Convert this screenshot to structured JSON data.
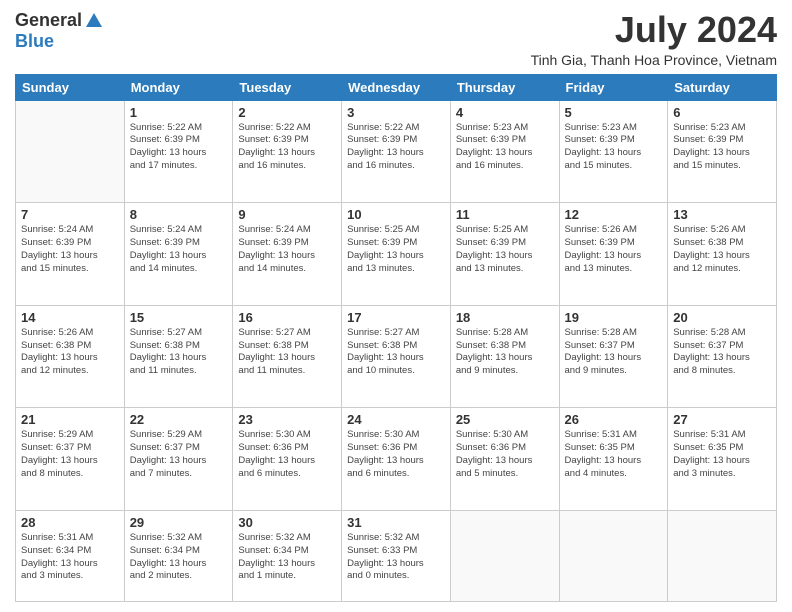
{
  "logo": {
    "general": "General",
    "blue": "Blue"
  },
  "header": {
    "month": "July 2024",
    "location": "Tinh Gia, Thanh Hoa Province, Vietnam"
  },
  "days_of_week": [
    "Sunday",
    "Monday",
    "Tuesday",
    "Wednesday",
    "Thursday",
    "Friday",
    "Saturday"
  ],
  "weeks": [
    [
      {
        "day": "",
        "info": ""
      },
      {
        "day": "1",
        "info": "Sunrise: 5:22 AM\nSunset: 6:39 PM\nDaylight: 13 hours\nand 17 minutes."
      },
      {
        "day": "2",
        "info": "Sunrise: 5:22 AM\nSunset: 6:39 PM\nDaylight: 13 hours\nand 16 minutes."
      },
      {
        "day": "3",
        "info": "Sunrise: 5:22 AM\nSunset: 6:39 PM\nDaylight: 13 hours\nand 16 minutes."
      },
      {
        "day": "4",
        "info": "Sunrise: 5:23 AM\nSunset: 6:39 PM\nDaylight: 13 hours\nand 16 minutes."
      },
      {
        "day": "5",
        "info": "Sunrise: 5:23 AM\nSunset: 6:39 PM\nDaylight: 13 hours\nand 15 minutes."
      },
      {
        "day": "6",
        "info": "Sunrise: 5:23 AM\nSunset: 6:39 PM\nDaylight: 13 hours\nand 15 minutes."
      }
    ],
    [
      {
        "day": "7",
        "info": "Sunrise: 5:24 AM\nSunset: 6:39 PM\nDaylight: 13 hours\nand 15 minutes."
      },
      {
        "day": "8",
        "info": "Sunrise: 5:24 AM\nSunset: 6:39 PM\nDaylight: 13 hours\nand 14 minutes."
      },
      {
        "day": "9",
        "info": "Sunrise: 5:24 AM\nSunset: 6:39 PM\nDaylight: 13 hours\nand 14 minutes."
      },
      {
        "day": "10",
        "info": "Sunrise: 5:25 AM\nSunset: 6:39 PM\nDaylight: 13 hours\nand 13 minutes."
      },
      {
        "day": "11",
        "info": "Sunrise: 5:25 AM\nSunset: 6:39 PM\nDaylight: 13 hours\nand 13 minutes."
      },
      {
        "day": "12",
        "info": "Sunrise: 5:26 AM\nSunset: 6:39 PM\nDaylight: 13 hours\nand 13 minutes."
      },
      {
        "day": "13",
        "info": "Sunrise: 5:26 AM\nSunset: 6:38 PM\nDaylight: 13 hours\nand 12 minutes."
      }
    ],
    [
      {
        "day": "14",
        "info": "Sunrise: 5:26 AM\nSunset: 6:38 PM\nDaylight: 13 hours\nand 12 minutes."
      },
      {
        "day": "15",
        "info": "Sunrise: 5:27 AM\nSunset: 6:38 PM\nDaylight: 13 hours\nand 11 minutes."
      },
      {
        "day": "16",
        "info": "Sunrise: 5:27 AM\nSunset: 6:38 PM\nDaylight: 13 hours\nand 11 minutes."
      },
      {
        "day": "17",
        "info": "Sunrise: 5:27 AM\nSunset: 6:38 PM\nDaylight: 13 hours\nand 10 minutes."
      },
      {
        "day": "18",
        "info": "Sunrise: 5:28 AM\nSunset: 6:38 PM\nDaylight: 13 hours\nand 9 minutes."
      },
      {
        "day": "19",
        "info": "Sunrise: 5:28 AM\nSunset: 6:37 PM\nDaylight: 13 hours\nand 9 minutes."
      },
      {
        "day": "20",
        "info": "Sunrise: 5:28 AM\nSunset: 6:37 PM\nDaylight: 13 hours\nand 8 minutes."
      }
    ],
    [
      {
        "day": "21",
        "info": "Sunrise: 5:29 AM\nSunset: 6:37 PM\nDaylight: 13 hours\nand 8 minutes."
      },
      {
        "day": "22",
        "info": "Sunrise: 5:29 AM\nSunset: 6:37 PM\nDaylight: 13 hours\nand 7 minutes."
      },
      {
        "day": "23",
        "info": "Sunrise: 5:30 AM\nSunset: 6:36 PM\nDaylight: 13 hours\nand 6 minutes."
      },
      {
        "day": "24",
        "info": "Sunrise: 5:30 AM\nSunset: 6:36 PM\nDaylight: 13 hours\nand 6 minutes."
      },
      {
        "day": "25",
        "info": "Sunrise: 5:30 AM\nSunset: 6:36 PM\nDaylight: 13 hours\nand 5 minutes."
      },
      {
        "day": "26",
        "info": "Sunrise: 5:31 AM\nSunset: 6:35 PM\nDaylight: 13 hours\nand 4 minutes."
      },
      {
        "day": "27",
        "info": "Sunrise: 5:31 AM\nSunset: 6:35 PM\nDaylight: 13 hours\nand 3 minutes."
      }
    ],
    [
      {
        "day": "28",
        "info": "Sunrise: 5:31 AM\nSunset: 6:34 PM\nDaylight: 13 hours\nand 3 minutes."
      },
      {
        "day": "29",
        "info": "Sunrise: 5:32 AM\nSunset: 6:34 PM\nDaylight: 13 hours\nand 2 minutes."
      },
      {
        "day": "30",
        "info": "Sunrise: 5:32 AM\nSunset: 6:34 PM\nDaylight: 13 hours\nand 1 minute."
      },
      {
        "day": "31",
        "info": "Sunrise: 5:32 AM\nSunset: 6:33 PM\nDaylight: 13 hours\nand 0 minutes."
      },
      {
        "day": "",
        "info": ""
      },
      {
        "day": "",
        "info": ""
      },
      {
        "day": "",
        "info": ""
      }
    ]
  ]
}
